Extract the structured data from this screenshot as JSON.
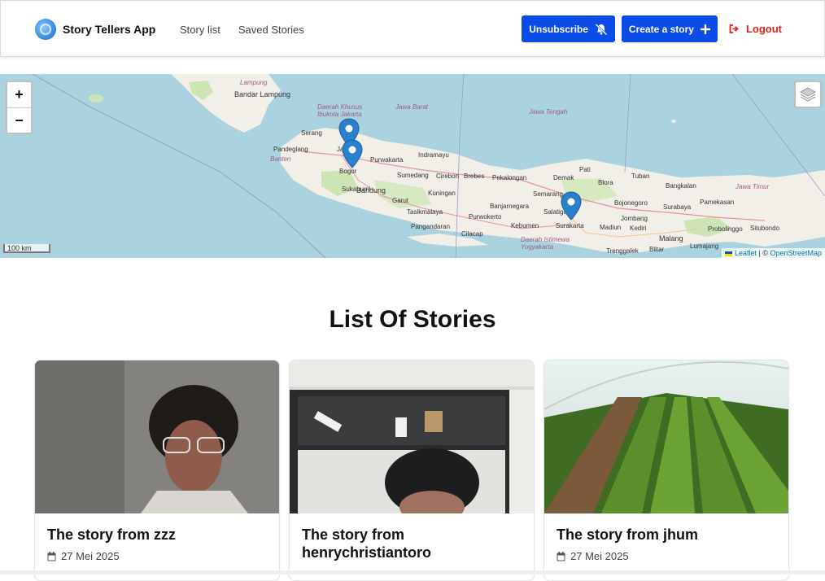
{
  "header": {
    "brand_name": "Story Tellers App",
    "nav": [
      "Story list",
      "Saved Stories"
    ],
    "unsubscribe_label": "Unsubscribe",
    "create_label": "Create a story",
    "logout_label": "Logout"
  },
  "map": {
    "zoom_in": "+",
    "zoom_out": "−",
    "scale_label": "100 km",
    "attribution_leaflet": "Leaflet",
    "attribution_sep": " | © ",
    "attribution_osm": "OpenStreetMap",
    "labels": [
      "Lampung",
      "Bandar Lampung",
      "Daerah Khusus Ibukota Jakarta",
      "Jawa Barat",
      "Jawa Tengah",
      "Serang",
      "Jakarta",
      "Pandeglang",
      "Banten",
      "Indramayu",
      "Purwakarta",
      "Bogor",
      "Sumedang",
      "Cirebon",
      "Brebes",
      "Pekalongan",
      "Demak",
      "Pati",
      "Tuban",
      "Bangkalan",
      "Jawa Timur",
      "Sukabumi",
      "Bandung",
      "Garut",
      "Kuningan",
      "Semarang",
      "Blora",
      "Bojonegoro",
      "Surabaya",
      "Pamekasan",
      "Tasikmalaya",
      "Banjarnegara",
      "Salatiga",
      "Jombang",
      "Purwokerto",
      "Surakarta",
      "Madiun",
      "Kediri",
      "Probolinggo",
      "Situbondo",
      "Pangandaran",
      "Cilacap",
      "Kebumen",
      "Daerah Istimewa Yogyakarta",
      "Malang",
      "Lumajang",
      "Trenggalek",
      "Blitar"
    ]
  },
  "page_title": "List Of Stories",
  "stories": [
    {
      "title": "The story from zzz",
      "date": "27 Mei 2025"
    },
    {
      "title": "The story from henrychristiantoro",
      "date": ""
    },
    {
      "title": "The story from jhum",
      "date": "27 Mei 2025"
    }
  ],
  "colors": {
    "primary": "#0b4be8",
    "logout": "#e0201b",
    "map_water": "#aad3df",
    "map_land": "#f2efe9"
  }
}
